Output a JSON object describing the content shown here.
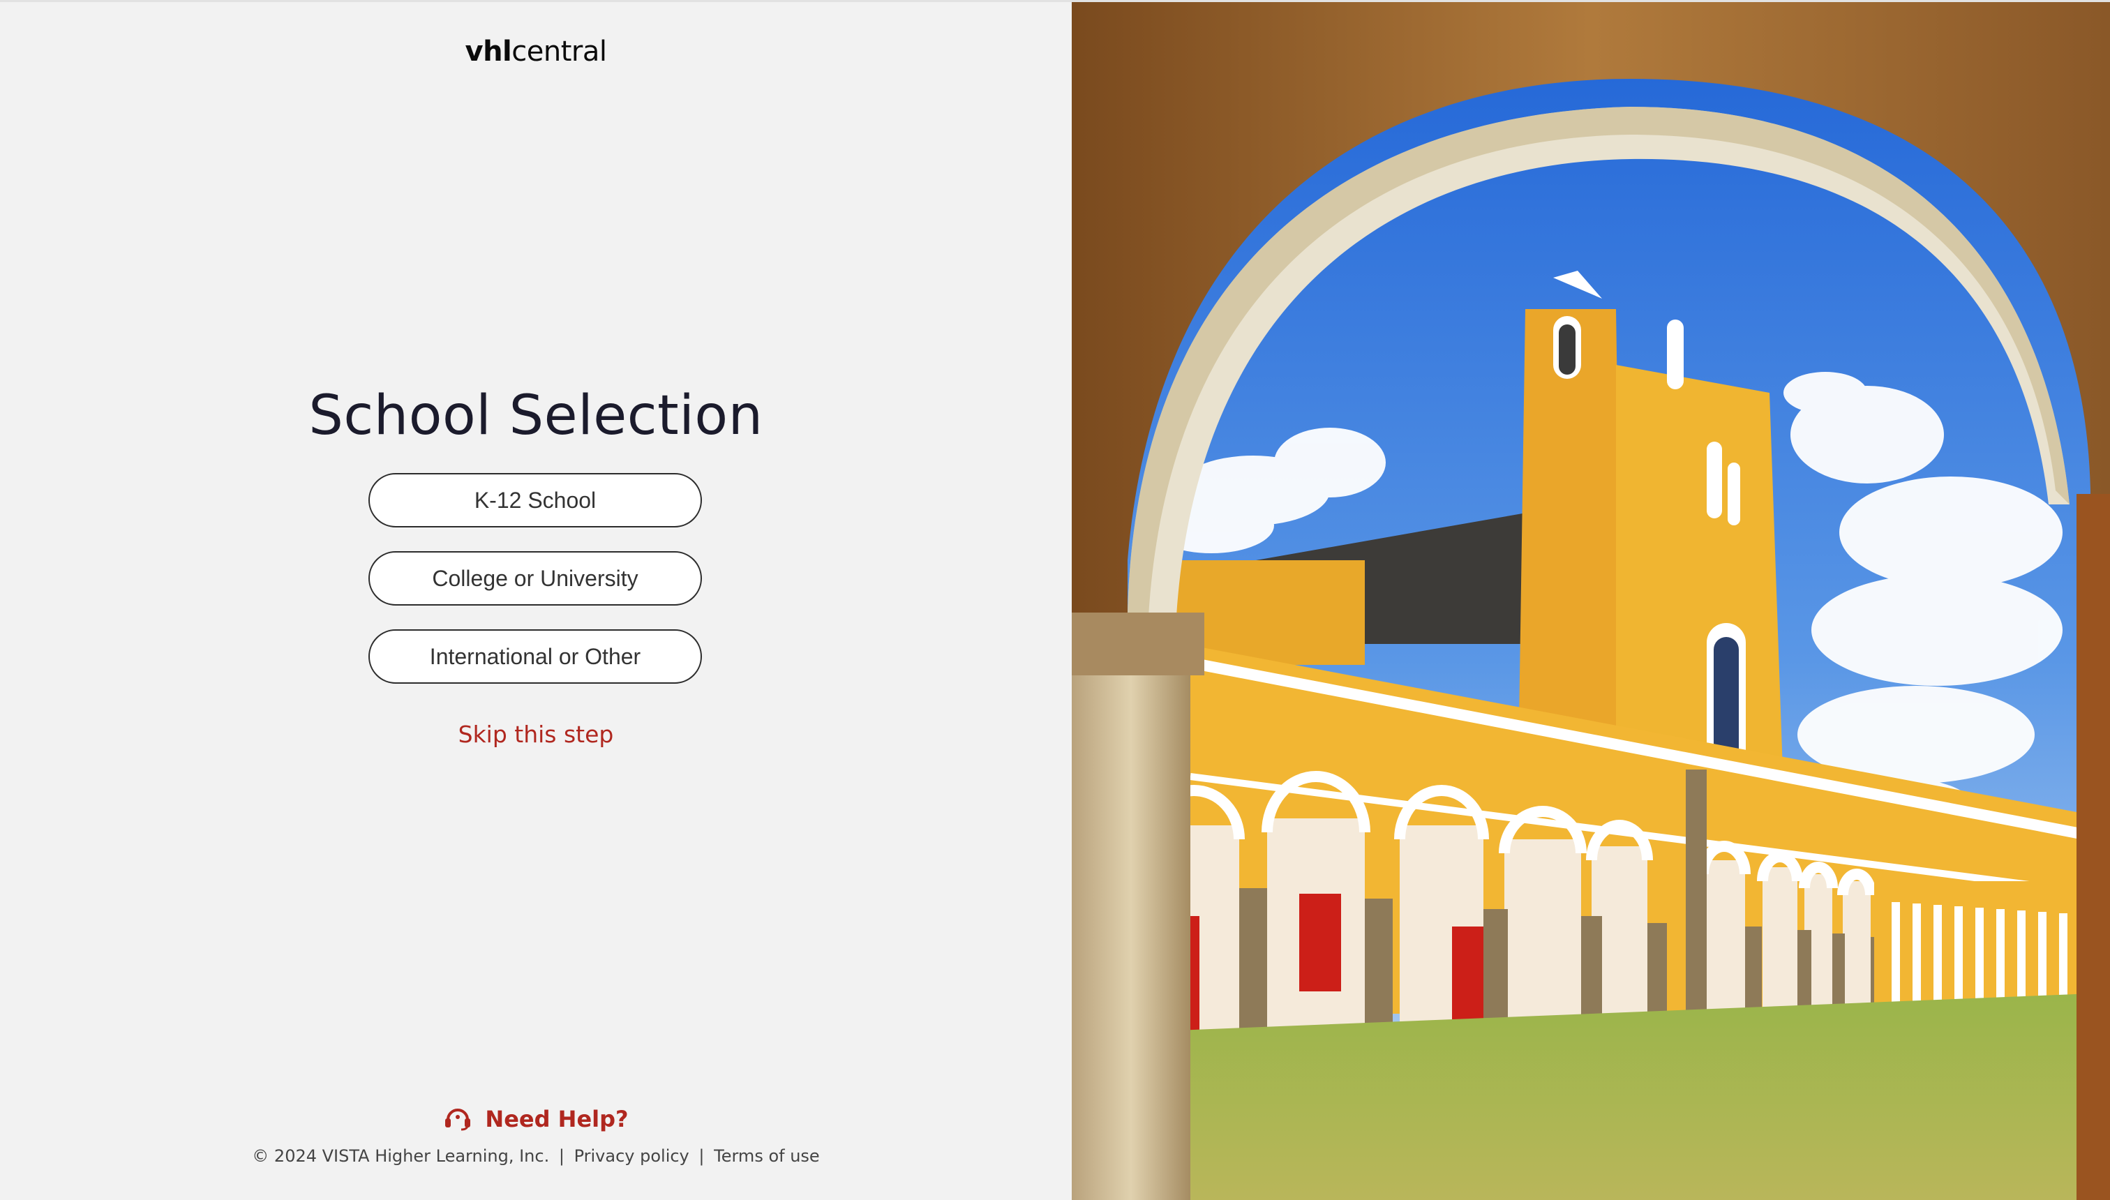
{
  "logo": {
    "bold": "vhl",
    "regular": "central"
  },
  "page": {
    "title": "School Selection"
  },
  "options": [
    {
      "label": "K-12 School"
    },
    {
      "label": "College or University"
    },
    {
      "label": "International or Other"
    }
  ],
  "skip_label": "Skip this step",
  "help": {
    "label": "Need Help?",
    "icon": "headset-icon"
  },
  "footer": {
    "copyright": "© 2024 VISTA Higher Learning, Inc.",
    "separator": "|",
    "privacy": "Privacy policy",
    "terms": "Terms of use"
  },
  "colors": {
    "accent": "#b0271f",
    "background": "#f2f2f2",
    "title": "#1b1b2c"
  }
}
